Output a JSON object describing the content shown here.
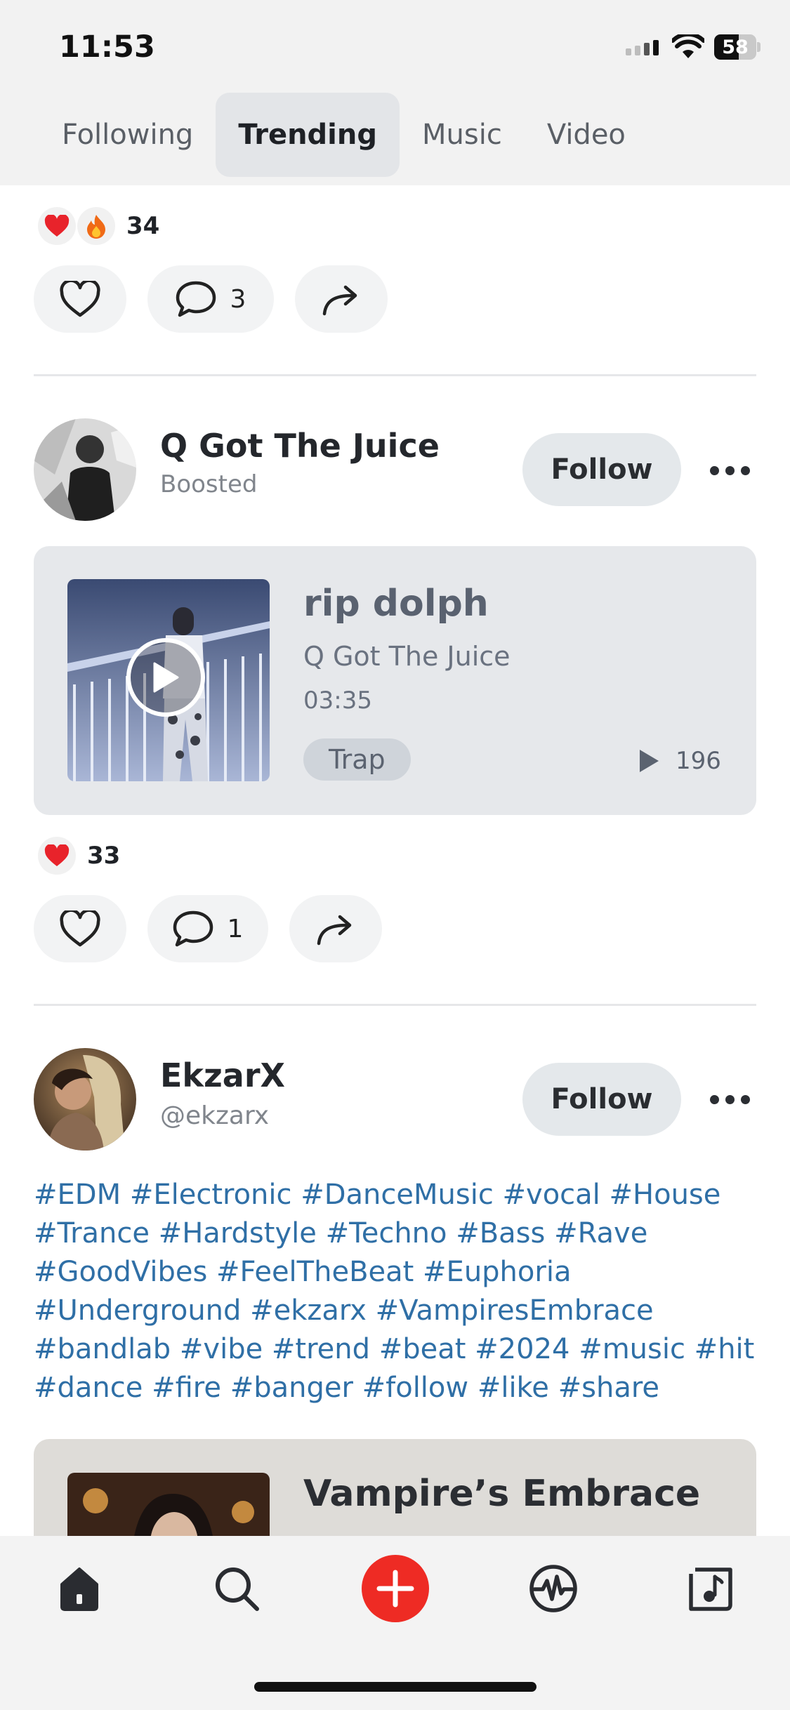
{
  "status": {
    "time": "11:53",
    "battery": "58"
  },
  "tabs": [
    {
      "label": "Following",
      "active": false
    },
    {
      "label": "Trending",
      "active": true
    },
    {
      "label": "Music",
      "active": false
    },
    {
      "label": "Video",
      "active": false
    }
  ],
  "post0": {
    "reaction_count": "34",
    "comment_count": "3"
  },
  "post1": {
    "name": "Q Got The Juice",
    "subtitle": "Boosted",
    "follow_label": "Follow",
    "track": {
      "title": "rip dolph",
      "artist": "Q Got The Juice",
      "duration": "03:35",
      "genre": "Trap",
      "plays": "196"
    },
    "reaction_count": "33",
    "comment_count": "1"
  },
  "post2": {
    "name": "EkzarX",
    "handle": "@ekzarx",
    "follow_label": "Follow",
    "hashtags": "#EDM #Electronic #DanceMusic #vocal #House #Trance #Hardstyle #Techno #Bass #Rave #GoodVibes #FeelTheBeat #Euphoria #Underground #ekzarx #VampiresEmbrace #bandlab  #vibe  #trend  #beat  #2024  #music #hit #dance #fire #banger #follow #like #share",
    "track_title": "Vampire’s Embrace"
  },
  "colors": {
    "accent_red": "#ee2b24",
    "hashtag": "#2f6fa6",
    "card_bg": "#e6e8eb"
  },
  "icons": [
    "heart-icon",
    "fire-icon",
    "comment-icon",
    "share-icon",
    "play-icon",
    "home-icon",
    "search-icon",
    "create-icon",
    "pulse-icon",
    "library-icon",
    "more-icon"
  ]
}
